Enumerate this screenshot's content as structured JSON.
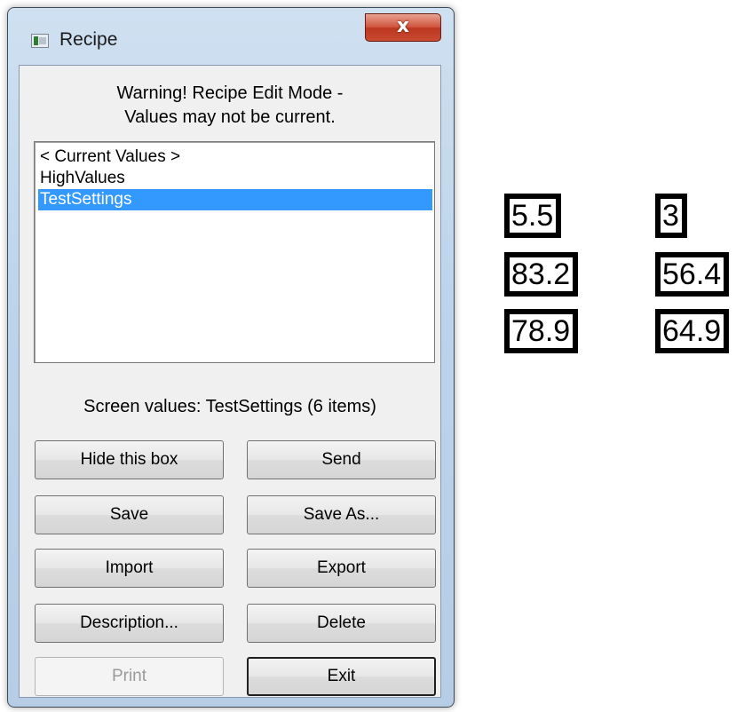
{
  "window": {
    "title": "Recipe",
    "close_label": "x"
  },
  "warning": {
    "line1": "Warning! Recipe Edit Mode -",
    "line2": "Values may not be current."
  },
  "recipe_list": {
    "items": [
      {
        "label": "< Current Values >",
        "selected": false
      },
      {
        "label": "HighValues",
        "selected": false
      },
      {
        "label": "TestSettings",
        "selected": true
      }
    ]
  },
  "status": {
    "screen_values": "Screen values: TestSettings (6 items)"
  },
  "buttons": {
    "hide": "Hide this box",
    "send": "Send",
    "save": "Save",
    "save_as": "Save As...",
    "import": "Import",
    "export": "Export",
    "description": "Description...",
    "delete": "Delete",
    "print": "Print",
    "exit": "Exit"
  },
  "values": {
    "col1": [
      "5.5",
      "83.2",
      "78.9"
    ],
    "col2": [
      "3",
      "56.4",
      "64.9"
    ]
  }
}
